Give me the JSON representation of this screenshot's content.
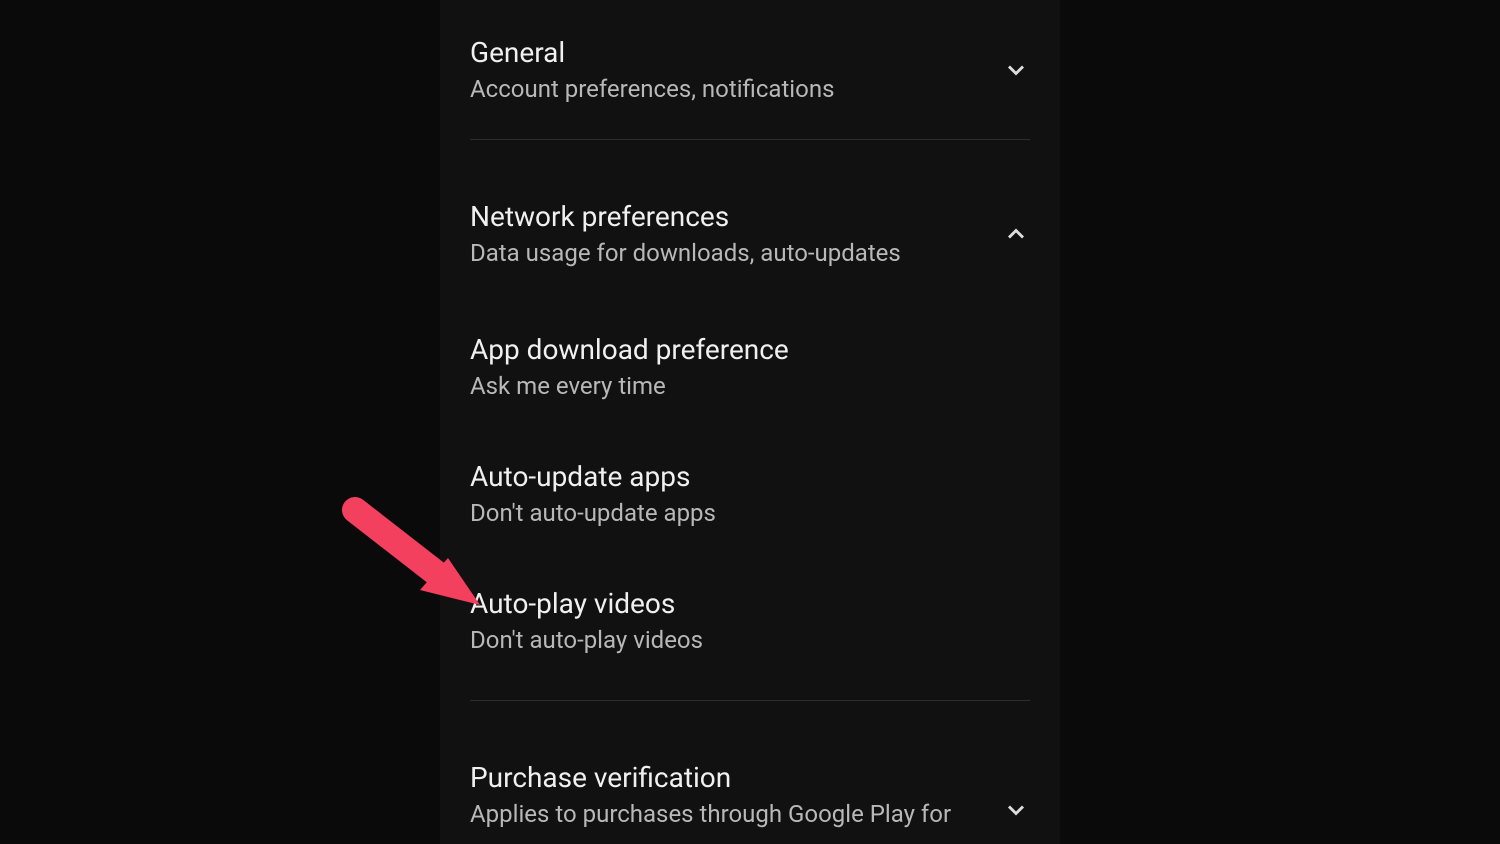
{
  "sections": {
    "general": {
      "title": "General",
      "subtitle": "Account preferences, notifications",
      "expanded": false
    },
    "network": {
      "title": "Network preferences",
      "subtitle": "Data usage for downloads, auto-updates",
      "expanded": true,
      "items": {
        "app_download": {
          "title": "App download preference",
          "subtitle": "Ask me every time"
        },
        "auto_update": {
          "title": "Auto-update apps",
          "subtitle": "Don't auto-update apps"
        },
        "auto_play": {
          "title": "Auto-play videos",
          "subtitle": "Don't auto-play videos"
        }
      }
    },
    "purchase": {
      "title": "Purchase verification",
      "subtitle": "Applies to purchases through Google Play for",
      "expanded": false
    }
  }
}
